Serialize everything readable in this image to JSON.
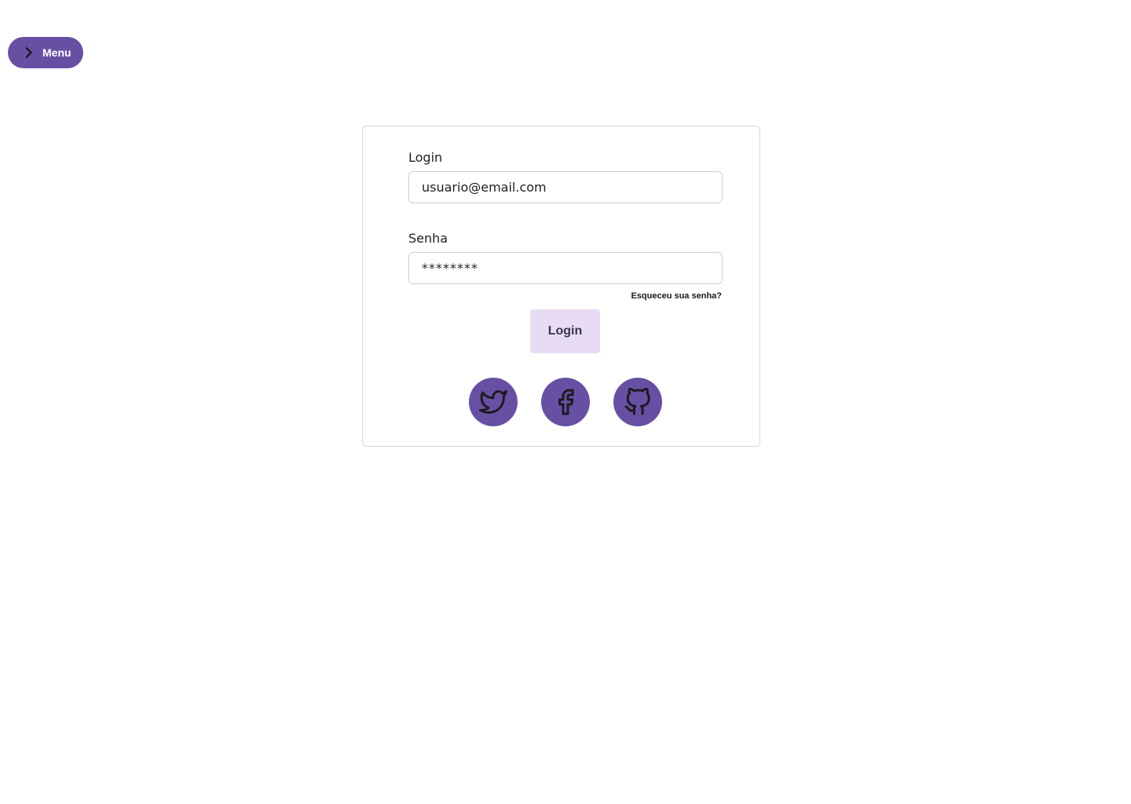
{
  "menu": {
    "label": "Menu",
    "icon": "chevron-right-icon"
  },
  "form": {
    "login_label": "Login",
    "login_value": "usuario@email.com",
    "password_label": "Senha",
    "password_value": "********",
    "forgot_label": "Esqueceu sua senha?",
    "submit_label": "Login"
  },
  "social": [
    {
      "name": "twitter",
      "icon": "twitter-icon"
    },
    {
      "name": "facebook",
      "icon": "facebook-icon"
    },
    {
      "name": "github",
      "icon": "github-icon"
    }
  ],
  "colors": {
    "primary": "#6750a4",
    "submit_bg": "#e8dcf4",
    "icon_stroke": "#1d1b20",
    "card_border": "#d6d6d6"
  }
}
